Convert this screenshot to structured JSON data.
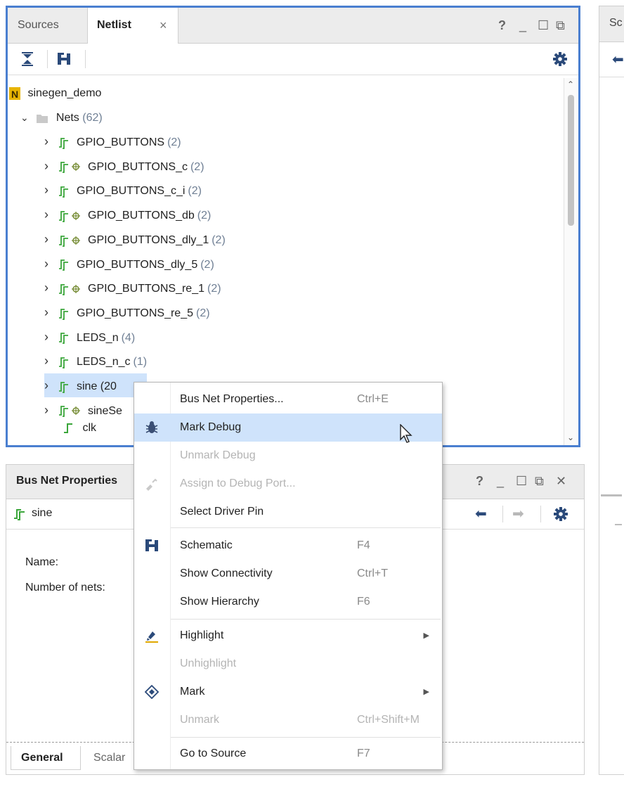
{
  "netlist_panel": {
    "tabs": [
      {
        "label": "Sources"
      },
      {
        "label": "Netlist"
      }
    ],
    "tab_close": "×",
    "header_controls": {
      "help": "?",
      "minimize": "_",
      "maximize": "☐",
      "float": "⧉"
    },
    "toolbar_icons": [
      "collapse-all-icon",
      "schematic-icon",
      "gear-icon"
    ],
    "tree": {
      "root": "sinegen_demo",
      "nets_folder": {
        "label": "Nets",
        "count": "(62)"
      },
      "items": [
        {
          "name": "GPIO_BUTTONS",
          "count": "(2)",
          "debug": false
        },
        {
          "name": "GPIO_BUTTONS_c",
          "count": "(2)",
          "debug": true
        },
        {
          "name": "GPIO_BUTTONS_c_i",
          "count": "(2)",
          "debug": false
        },
        {
          "name": "GPIO_BUTTONS_db",
          "count": "(2)",
          "debug": true
        },
        {
          "name": "GPIO_BUTTONS_dly_1",
          "count": "(2)",
          "debug": true
        },
        {
          "name": "GPIO_BUTTONS_dly_5",
          "count": "(2)",
          "debug": false
        },
        {
          "name": "GPIO_BUTTONS_re_1",
          "count": "(2)",
          "debug": true
        },
        {
          "name": "GPIO_BUTTONS_re_5",
          "count": "(2)",
          "debug": false
        },
        {
          "name": "LEDS_n",
          "count": "(4)",
          "debug": false
        },
        {
          "name": "LEDS_n_c",
          "count": "(1)",
          "debug": false
        },
        {
          "name": "sine (20",
          "count": "",
          "debug": false
        },
        {
          "name": "sineSe",
          "count": "",
          "debug": true
        }
      ],
      "clk_label": "clk"
    }
  },
  "props_panel": {
    "title": "Bus Net Properties",
    "controls": {
      "help": "?",
      "minimize": "_",
      "maximize": "☐",
      "float": "⧉",
      "close": "✕"
    },
    "object_name": "sine",
    "fields": [
      {
        "label": "Name:"
      },
      {
        "label": "Number of nets:"
      }
    ],
    "tabs": [
      {
        "label": "General"
      },
      {
        "label": "Scalar"
      }
    ]
  },
  "right_panel": {
    "tab_label": "Sc"
  },
  "context_menu": {
    "items": [
      {
        "label": "Bus Net Properties...",
        "shortcut": "Ctrl+E"
      },
      {
        "label": "Mark Debug",
        "shortcut": ""
      },
      {
        "label": "Unmark Debug",
        "shortcut": ""
      },
      {
        "label": "Assign to Debug Port...",
        "shortcut": ""
      },
      {
        "label": "Select Driver Pin",
        "shortcut": ""
      },
      {
        "label": "Schematic",
        "shortcut": "F4"
      },
      {
        "label": "Show Connectivity",
        "shortcut": "Ctrl+T"
      },
      {
        "label": "Show Hierarchy",
        "shortcut": "F6"
      },
      {
        "label": "Highlight",
        "shortcut": ""
      },
      {
        "label": "Unhighlight",
        "shortcut": ""
      },
      {
        "label": "Mark",
        "shortcut": ""
      },
      {
        "label": "Unmark",
        "shortcut": "Ctrl+Shift+M"
      },
      {
        "label": "Go to Source",
        "shortcut": "F7"
      }
    ]
  },
  "colors": {
    "accent": "#4a7fd0",
    "selection": "#cfe3fb",
    "net_green": "#3aa63a",
    "count_gray": "#6f7f94"
  }
}
